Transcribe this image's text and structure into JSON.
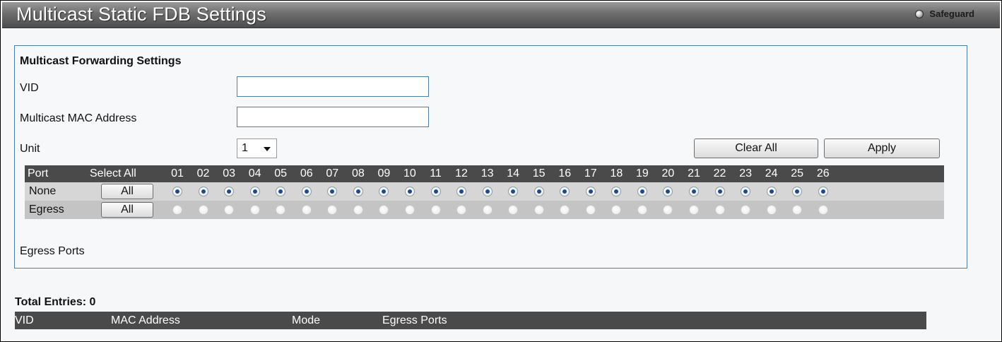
{
  "window": {
    "title": "Multicast Static FDB Settings",
    "safeguard_label": "Safeguard"
  },
  "form": {
    "section_title": "Multicast Forwarding Settings",
    "vid_label": "VID",
    "vid_value": "",
    "mac_label": "Multicast MAC Address",
    "mac_value": "",
    "unit_label": "Unit",
    "unit_value": "1",
    "clear_all_label": "Clear All",
    "apply_label": "Apply"
  },
  "port_table": {
    "port_header": "Port",
    "select_all_header": "Select All",
    "ports": [
      "01",
      "02",
      "03",
      "04",
      "05",
      "06",
      "07",
      "08",
      "09",
      "10",
      "11",
      "12",
      "13",
      "14",
      "15",
      "16",
      "17",
      "18",
      "19",
      "20",
      "21",
      "22",
      "23",
      "24",
      "25",
      "26"
    ],
    "rows": [
      {
        "label": "None",
        "button": "All",
        "selected": true
      },
      {
        "label": "Egress",
        "button": "All",
        "selected": false
      }
    ]
  },
  "egress_ports_label": "Egress Ports",
  "results": {
    "total_label": "Total Entries: 0",
    "columns": [
      "VID",
      "MAC Address",
      "Mode",
      "Egress Ports"
    ]
  }
}
